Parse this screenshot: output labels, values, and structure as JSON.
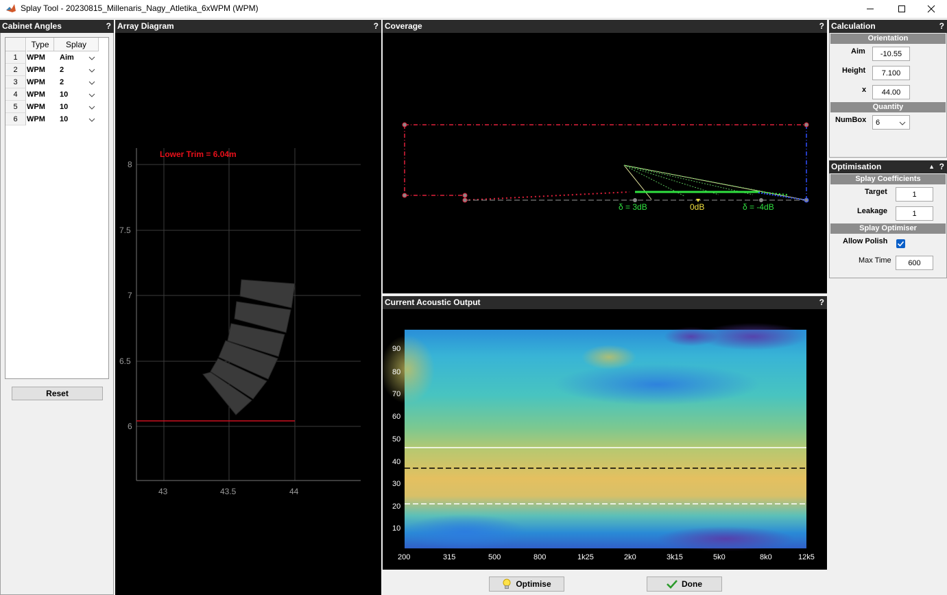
{
  "window": {
    "title": "Splay Tool - 20230815_Millenaris_Nagy_Atletika_6xWPM (WPM)",
    "controls": [
      "minimize-icon",
      "maximize-icon",
      "close-icon"
    ]
  },
  "cabinet_angles": {
    "title": "Cabinet Angles",
    "help": "?",
    "columns": [
      "Type",
      "Splay"
    ],
    "rows": [
      {
        "num": "1",
        "type": "WPM",
        "splay": "Aim"
      },
      {
        "num": "2",
        "type": "WPM",
        "splay": "2"
      },
      {
        "num": "3",
        "type": "WPM",
        "splay": "2"
      },
      {
        "num": "4",
        "type": "WPM",
        "splay": "10"
      },
      {
        "num": "5",
        "type": "WPM",
        "splay": "10"
      },
      {
        "num": "6",
        "type": "WPM",
        "splay": "10"
      }
    ],
    "reset_label": "Reset"
  },
  "array_diagram": {
    "title": "Array Diagram",
    "help": "?",
    "trim_label": "Lower Trim = 6.04m",
    "y_ticks": [
      "8",
      "7.5",
      "7",
      "6.5",
      "6"
    ],
    "x_ticks": [
      "43",
      "43.5",
      "44"
    ],
    "trim_color": "#ff1a1a"
  },
  "coverage": {
    "title": "Coverage",
    "help": "?",
    "labels": {
      "left": "δ = 3dB",
      "mid": "0dB",
      "right": "δ = -4dB"
    },
    "colors": {
      "boundary": "#e0203a",
      "right_edge": "#3050ff",
      "green": "#30e040",
      "mid": "#f0e040"
    }
  },
  "acoustic_output": {
    "title": "Current Acoustic Output",
    "help": "?",
    "y_ticks": [
      "90",
      "80",
      "70",
      "60",
      "50",
      "40",
      "30",
      "20",
      "10"
    ],
    "x_ticks": [
      "200",
      "315",
      "500",
      "800",
      "1k25",
      "2k0",
      "3k15",
      "5k0",
      "8k0",
      "12k5"
    ]
  },
  "calculation": {
    "title": "Calculation",
    "help": "?",
    "orientation_header": "Orientation",
    "aim_label": "Aim",
    "aim_value": "-10.55",
    "height_label": "Height",
    "height_value": "7.100",
    "x_label": "x",
    "x_value": "44.00",
    "quantity_header": "Quantity",
    "numbox_label": "NumBox",
    "numbox_value": "6"
  },
  "optimisation": {
    "title": "Optimisation",
    "help": "?",
    "collapse": "▲",
    "coefficients_header": "Splay Coefficients",
    "target_label": "Target",
    "target_value": "1",
    "leakage_label": "Leakage",
    "leakage_value": "1",
    "optimiser_header": "Splay Optimiser",
    "allow_polish_label": "Allow Polish",
    "allow_polish_checked": true,
    "max_time_label": "Max Time",
    "max_time_value": "600"
  },
  "actions": {
    "optimise_label": "Optimise",
    "done_label": "Done"
  }
}
